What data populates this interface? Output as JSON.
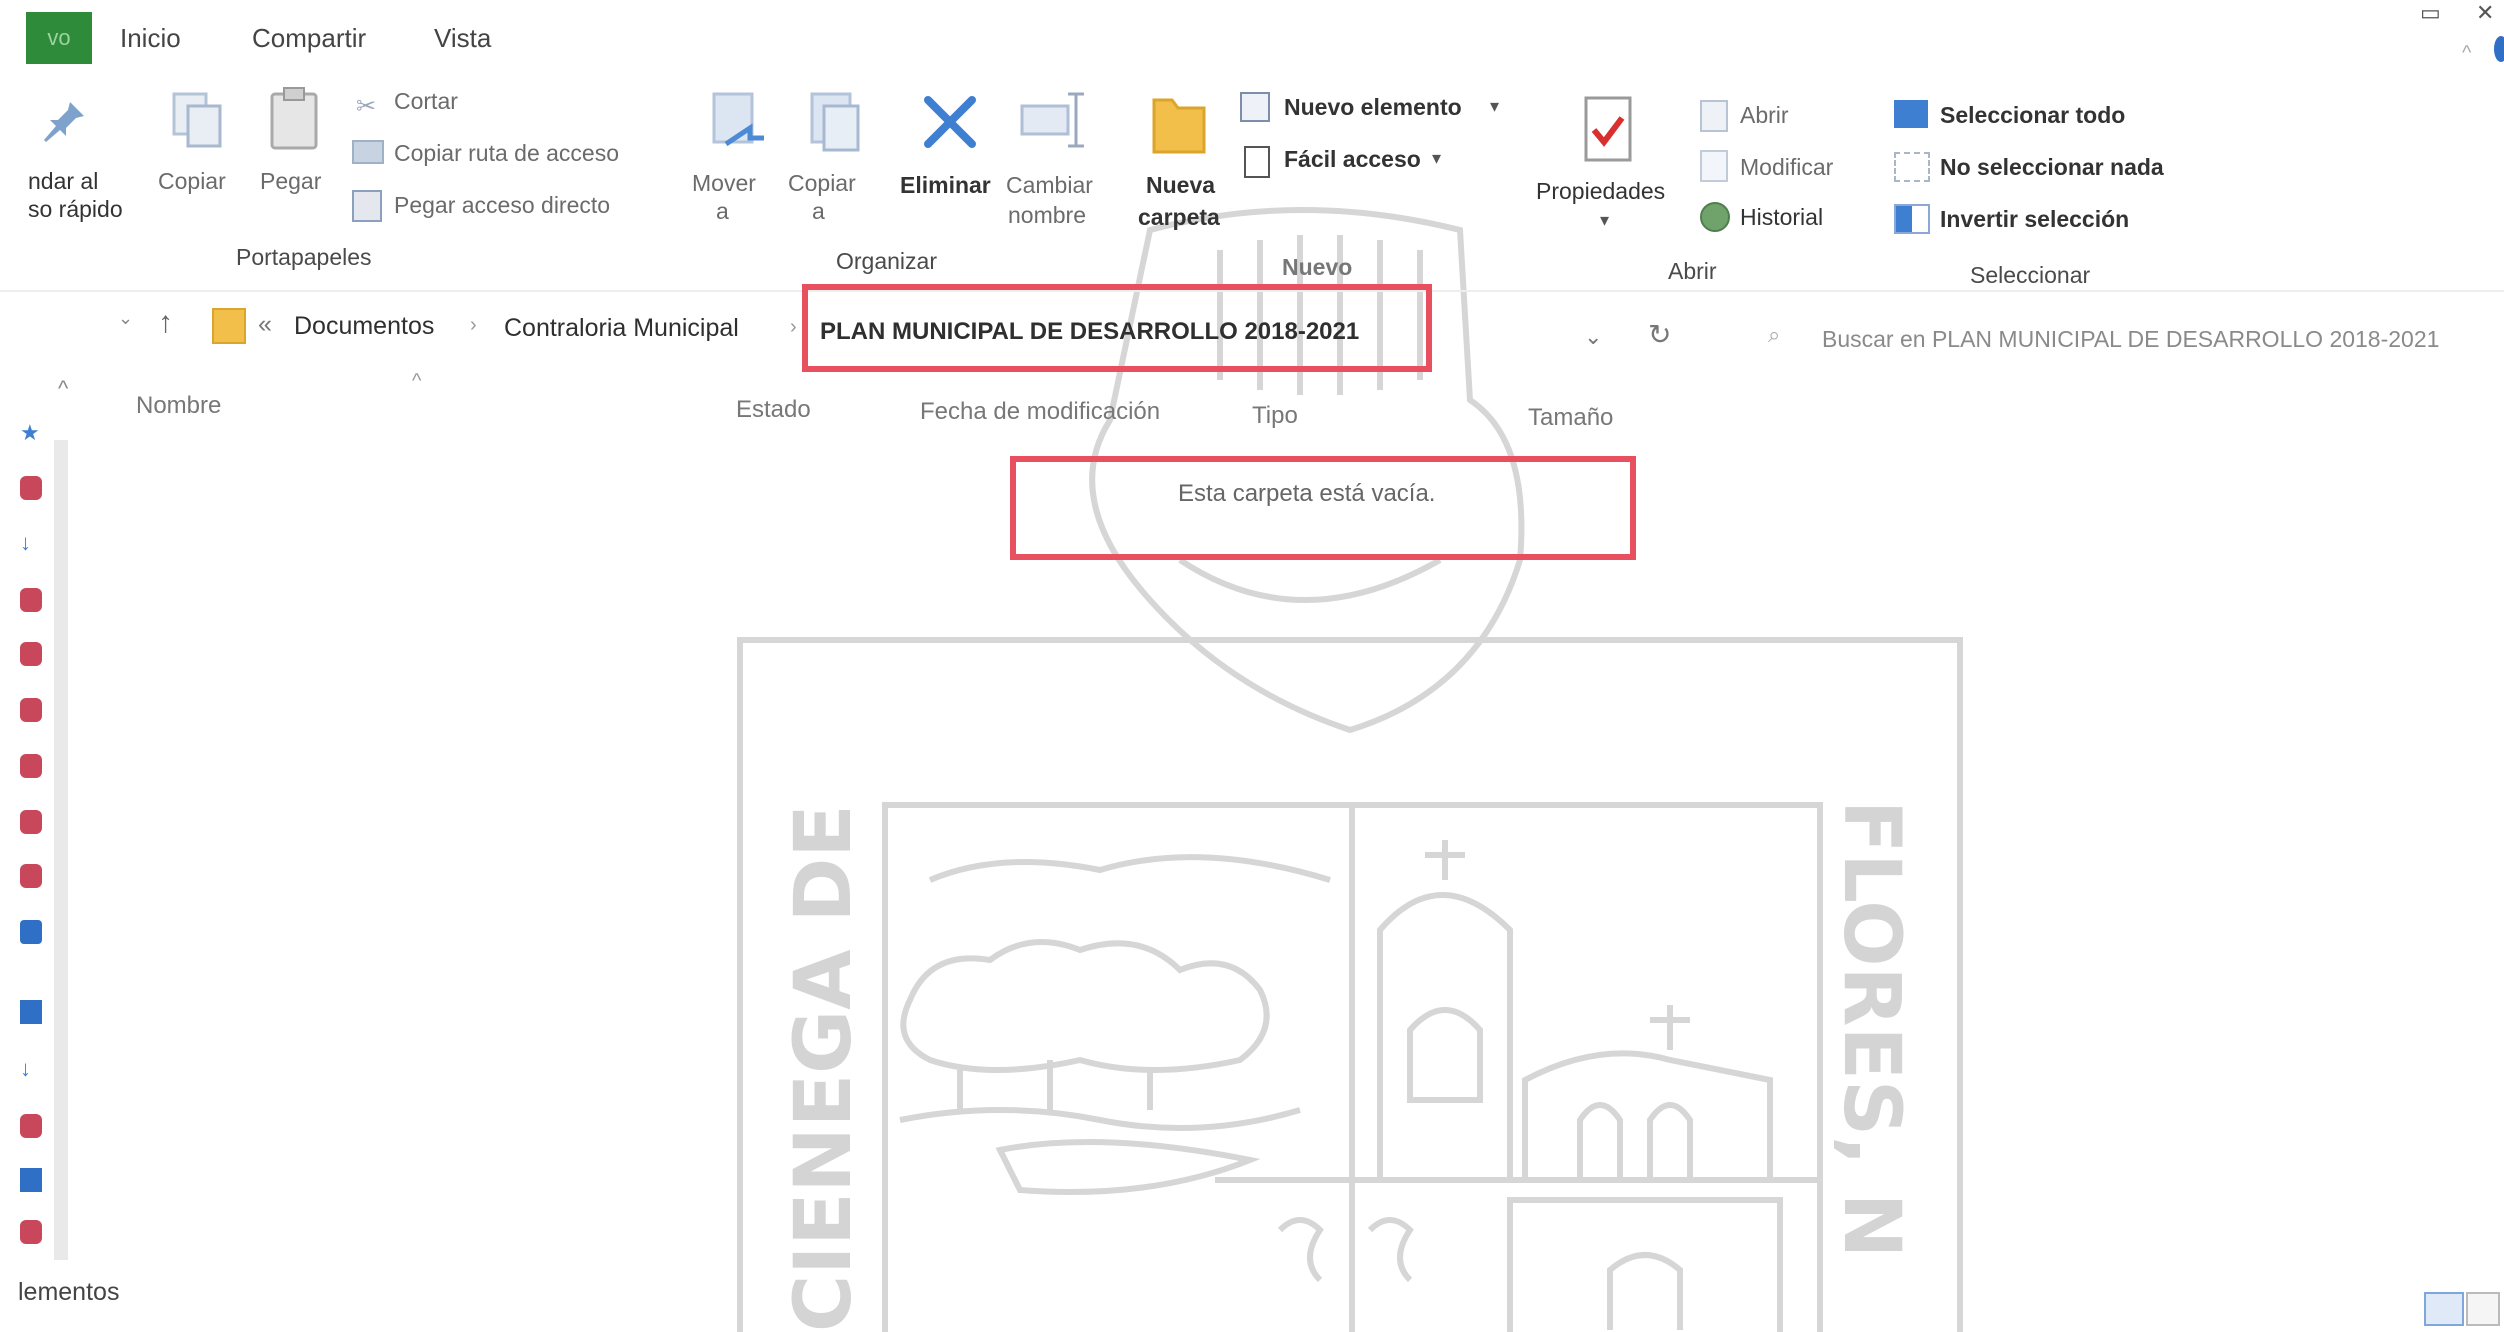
{
  "tabs": {
    "file": "vo",
    "home": "Inicio",
    "share": "Compartir",
    "view": "Vista"
  },
  "ribbon": {
    "pin_label": "ndar al\nso rápido",
    "pin_line1": "ndar al",
    "pin_line2": "so rápido",
    "copy": "Copiar",
    "paste": "Pegar",
    "cut": "Cortar",
    "copy_path": "Copiar ruta de acceso",
    "paste_shortcut": "Pegar acceso directo",
    "group_clipboard": "Portapapeles",
    "move_to": "Mover",
    "move_to_2": "a",
    "copy_to": "Copiar",
    "copy_to_2": "a",
    "delete": "Eliminar",
    "rename": "Cambiar",
    "rename_2": "nombre",
    "group_organize": "Organizar",
    "new_folder": "Nueva",
    "new_folder_2": "carpeta",
    "new_item": "Nuevo elemento",
    "easy_access": "Fácil acceso",
    "group_new": "Nuevo",
    "properties": "Propiedades",
    "open": "Abrir",
    "edit": "Modificar",
    "history": "Historial",
    "group_open": "Abrir",
    "select_all": "Seleccionar todo",
    "select_none": "No seleccionar nada",
    "invert_selection": "Invertir selección",
    "group_select": "Seleccionar"
  },
  "address": {
    "overflow": "«",
    "crumb1": "Documentos",
    "crumb2": "Contraloria Municipal",
    "crumb3": "PLAN MUNICIPAL DE DESARROLLO 2018-2021",
    "search_placeholder": "Buscar en PLAN MUNICIPAL DE DESARROLLO 2018-2021"
  },
  "columns": {
    "name": "Nombre",
    "status": "Estado",
    "modified": "Fecha de modificación",
    "type": "Tipo",
    "size": "Tamaño"
  },
  "content": {
    "empty_message": "Esta carpeta está vacía."
  },
  "statusbar": {
    "items": "lementos"
  },
  "watermark": {
    "left_text": "CIENEGA DE",
    "right_text": "FLORES, N"
  },
  "colors": {
    "highlight": "#e8505f",
    "file_tab": "#2e8b3a",
    "accent_blue": "#2f6fc5"
  }
}
